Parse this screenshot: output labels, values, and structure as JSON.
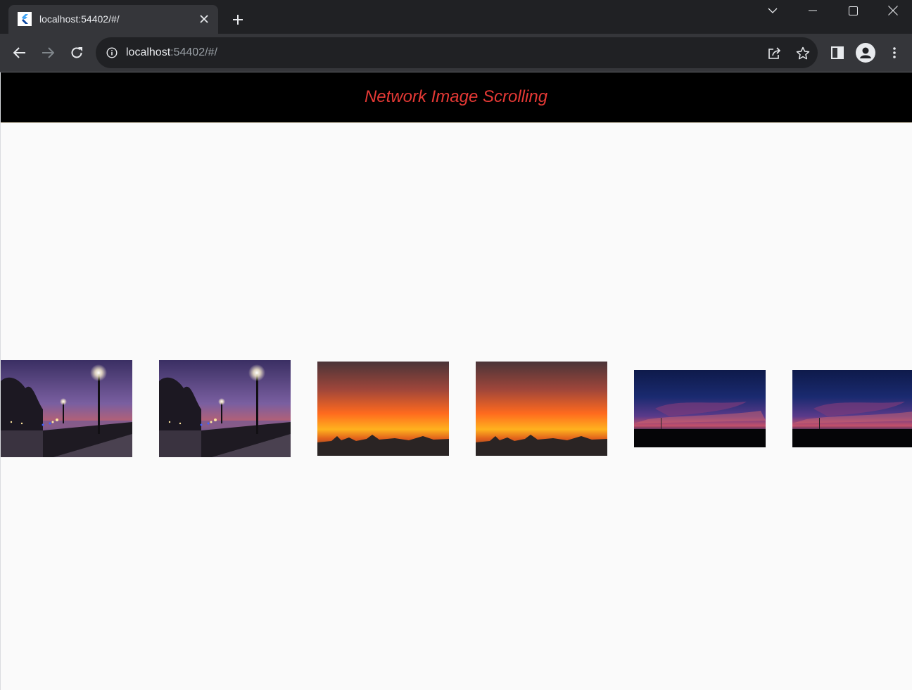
{
  "browser": {
    "tab_title": "localhost:54402/#/",
    "url_host": "localhost",
    "url_rest": ":54402/#/"
  },
  "app": {
    "title": "Network Image Scrolling",
    "title_color": "#e53935",
    "appbar_color": "#000000"
  },
  "images": [
    {
      "name": "promenade-night-image",
      "scene": "promenade"
    },
    {
      "name": "promenade-night-image",
      "scene": "promenade"
    },
    {
      "name": "orange-sunset-image",
      "scene": "sunset"
    },
    {
      "name": "orange-sunset-image",
      "scene": "sunset"
    },
    {
      "name": "blue-dusk-image",
      "scene": "dusk"
    },
    {
      "name": "blue-dusk-image",
      "scene": "dusk"
    }
  ]
}
